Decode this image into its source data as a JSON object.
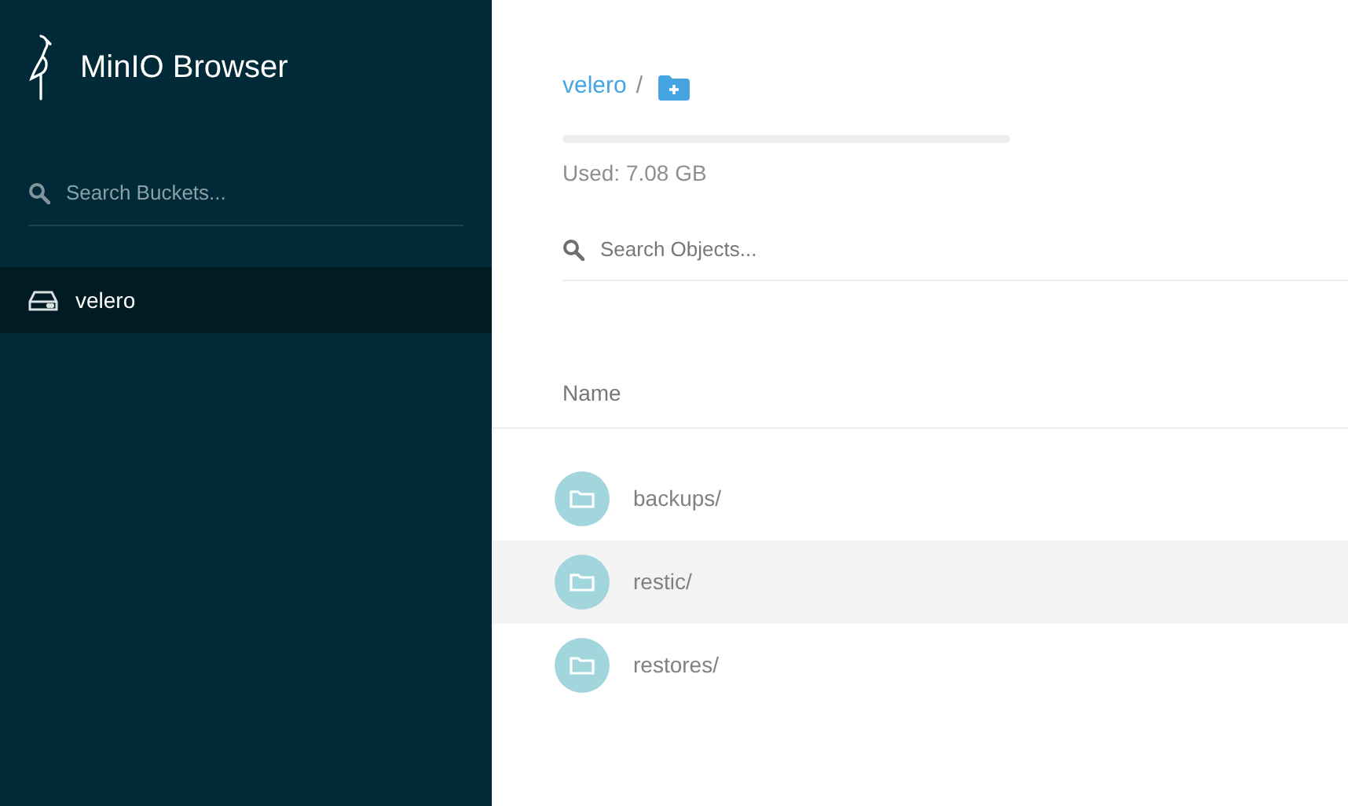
{
  "sidebar": {
    "title": "MinIO Browser",
    "search": {
      "placeholder": "Search Buckets..."
    },
    "buckets": [
      {
        "name": "velero",
        "selected": true
      }
    ]
  },
  "main": {
    "breadcrumb": [
      {
        "label": "velero"
      },
      {
        "label": "/"
      }
    ],
    "usage": {
      "level": 0,
      "reading": "Used: 7.08 GB"
    },
    "search": {
      "placeholder": "Search Objects..."
    },
    "table": {
      "columns": [
        "Name"
      ],
      "rows": [
        {
          "name": "backups/",
          "selected": false
        },
        {
          "name": "restic/",
          "selected": true
        },
        {
          "name": "restores/",
          "selected": false
        }
      ]
    }
  }
}
